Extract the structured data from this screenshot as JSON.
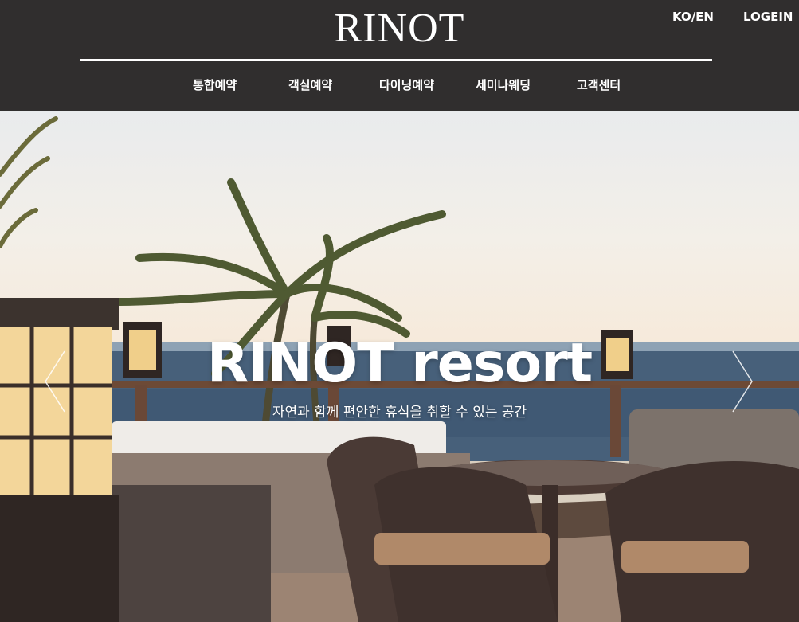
{
  "header": {
    "logo": "RINOT",
    "lang_toggle": "KO/EN",
    "login": "LOGEIN"
  },
  "nav": {
    "items": [
      {
        "label": "통합예약"
      },
      {
        "label": "객실예약"
      },
      {
        "label": "다이닝예약"
      },
      {
        "label": "세미나웨딩"
      },
      {
        "label": "고객센터"
      }
    ]
  },
  "hero": {
    "title": "RINOT resort",
    "subtitle": "자연과 함께 편안한 휴식을 취할 수 있는 공간",
    "prev_icon": "chevron-left-icon",
    "next_icon": "chevron-right-icon"
  },
  "colors": {
    "header_bg": "#302e2e",
    "text": "#ffffff"
  }
}
